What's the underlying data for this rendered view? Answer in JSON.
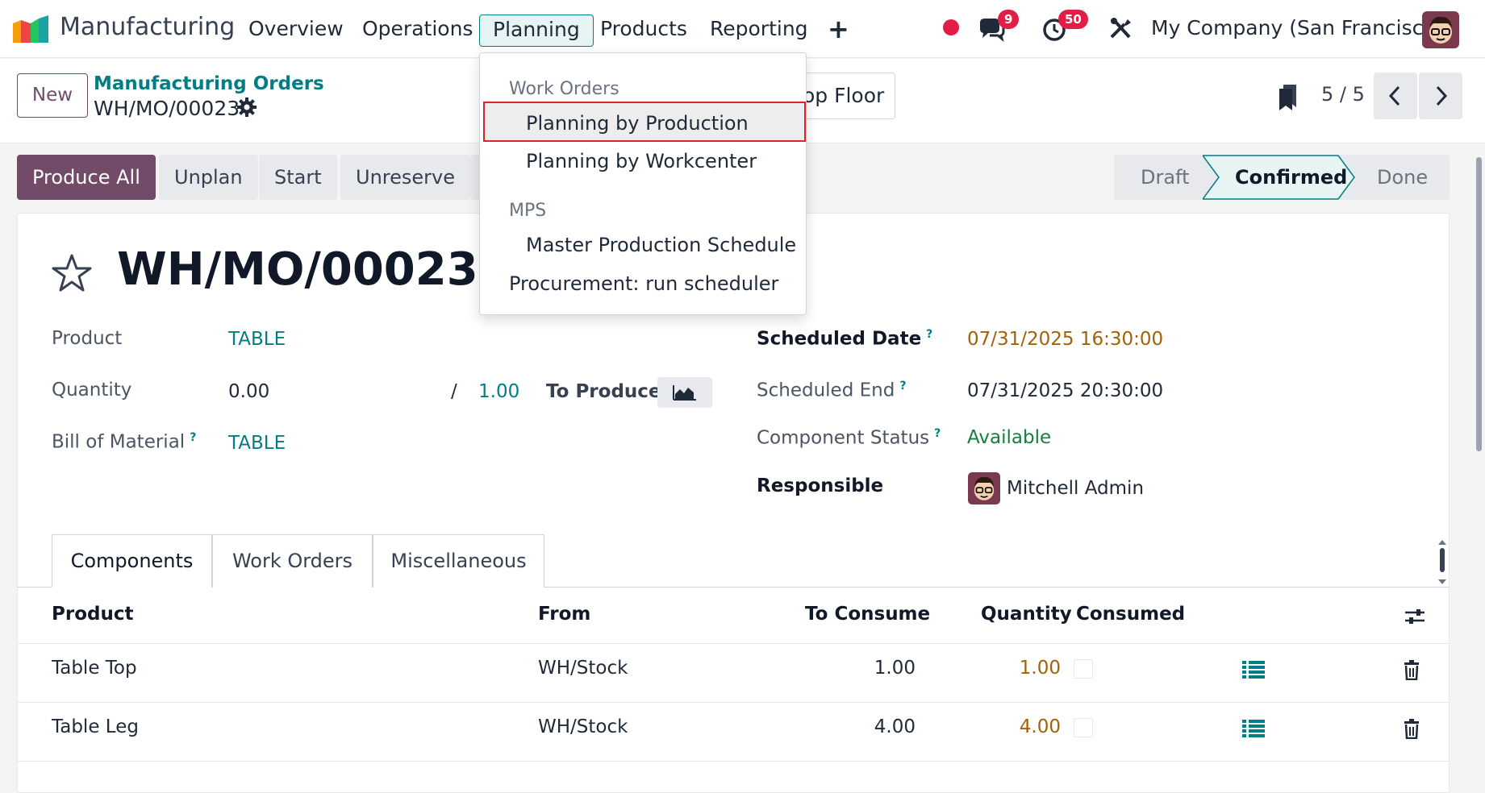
{
  "topbar": {
    "app_name": "Manufacturing",
    "nav": [
      "Overview",
      "Operations",
      "Planning",
      "Products",
      "Reporting"
    ],
    "add_label": "+",
    "messages_count": "9",
    "activities_count": "50",
    "company": "My Company (San Francisco)"
  },
  "control": {
    "new_label": "New",
    "breadcrumb": "Manufacturing Orders",
    "record": "WH/MO/00023",
    "shop_floor": "op Floor",
    "pager": "5 / 5"
  },
  "actions": [
    "Produce All",
    "Unplan",
    "Start",
    "Unreserve"
  ],
  "status": {
    "steps": [
      "Draft",
      "Confirmed",
      "Done"
    ],
    "current": "Confirmed"
  },
  "form": {
    "title": "WH/MO/00023",
    "product_label": "Product",
    "product": "TABLE",
    "quantity_label": "Quantity",
    "quantity": "0.00",
    "slash": "/",
    "qty_to_produce": "1.00",
    "to_produce_label": "To Produce",
    "bom_label": "Bill of Material",
    "bom": "TABLE",
    "help": "?",
    "scheduled_date_label": "Scheduled Date",
    "scheduled_date": "07/31/2025 16:30:00",
    "scheduled_end_label": "Scheduled End",
    "scheduled_end": "07/31/2025 20:30:00",
    "component_status_label": "Component Status",
    "component_status": "Available",
    "responsible_label": "Responsible",
    "responsible": "Mitchell Admin"
  },
  "tabs": [
    "Components",
    "Work Orders",
    "Miscellaneous"
  ],
  "table": {
    "headers": [
      "Product",
      "From",
      "To Consume",
      "Quantity",
      "Consumed"
    ],
    "rows": [
      {
        "product": "Table Top",
        "from": "WH/Stock",
        "to_consume": "1.00",
        "quantity": "1.00"
      },
      {
        "product": "Table Leg",
        "from": "WH/Stock",
        "to_consume": "4.00",
        "quantity": "4.00"
      }
    ]
  },
  "dropdown": {
    "header_work_orders": "Work Orders",
    "planning_by_production": "Planning by Production",
    "planning_by_workcenter": "Planning by Workcenter",
    "header_mps": "MPS",
    "master_production_schedule": "Master Production Schedule",
    "procurement": "Procurement: run scheduler"
  },
  "colors": {
    "brand": "#714b67",
    "accent": "#017e84",
    "badge": "#e11d48",
    "highlight_border": "#dc2626"
  }
}
